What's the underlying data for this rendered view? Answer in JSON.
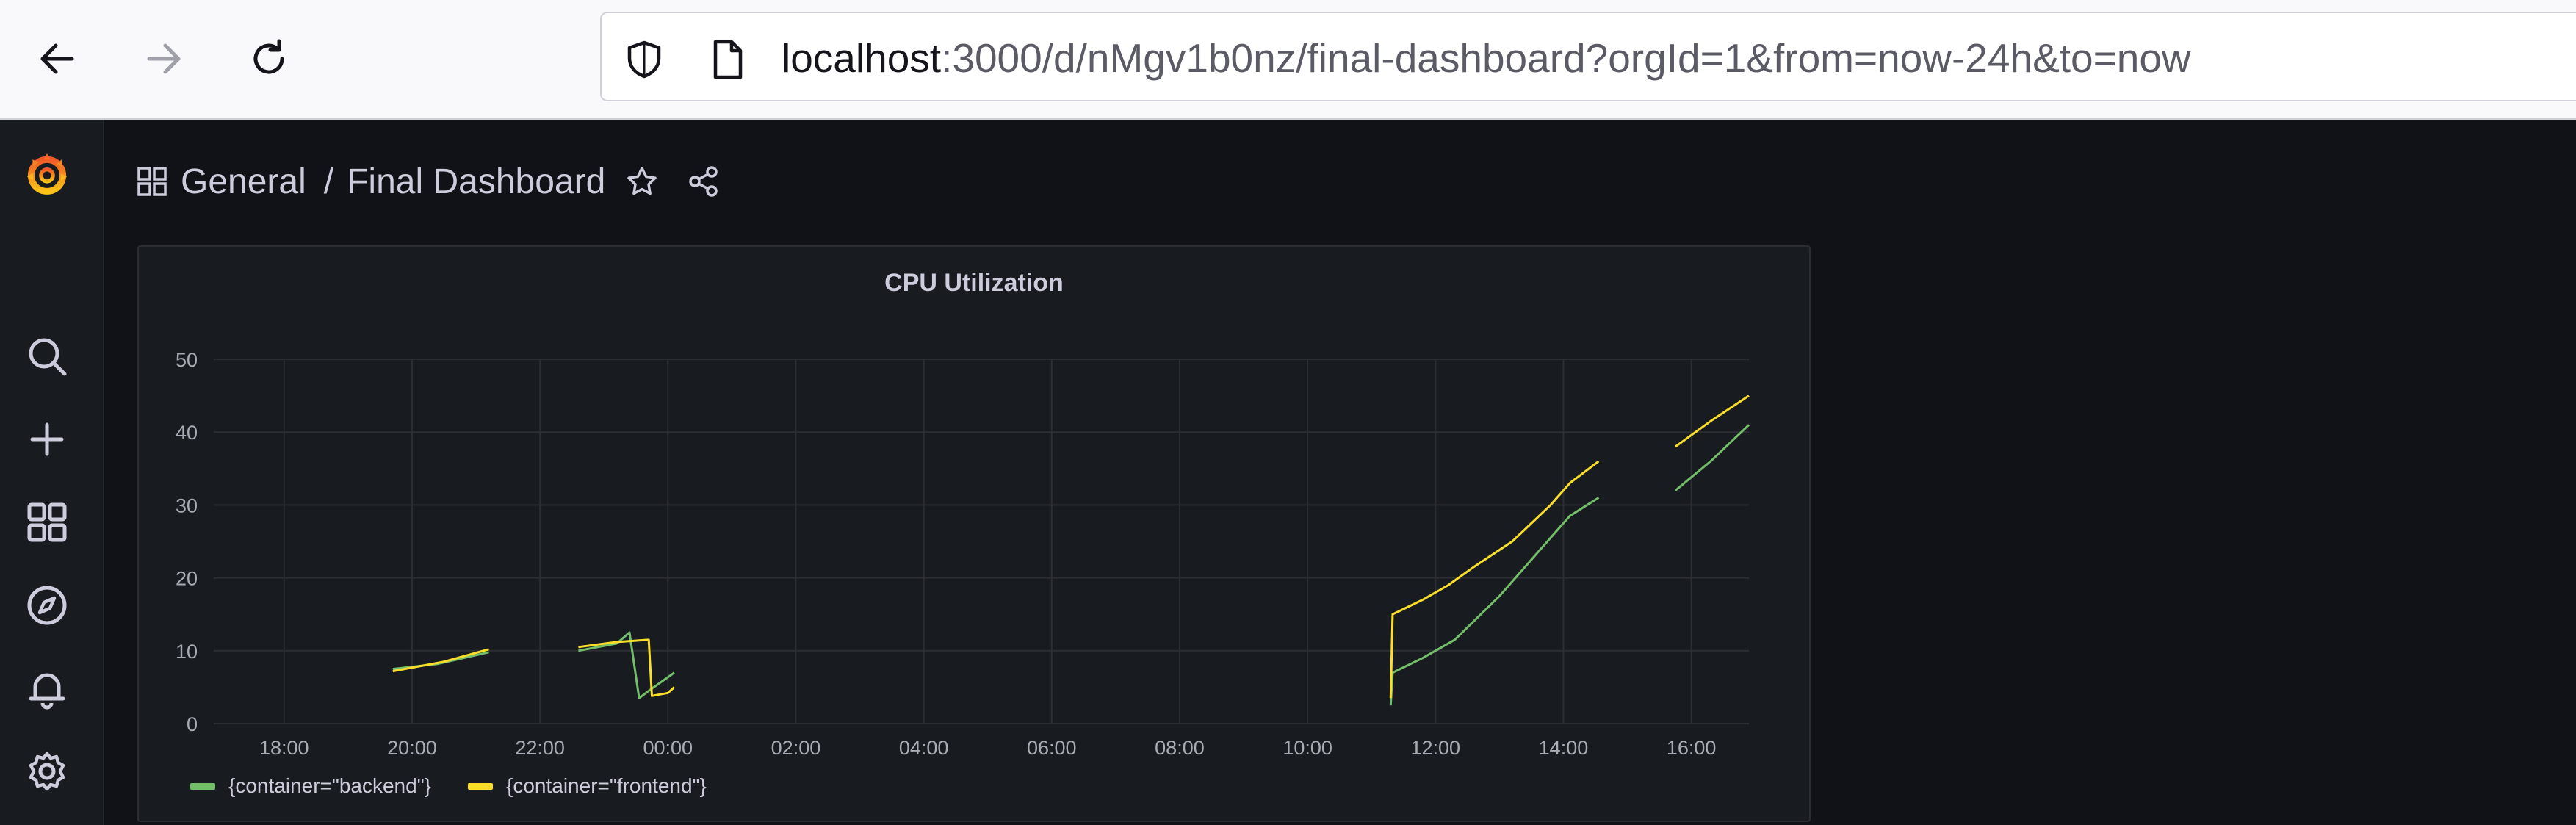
{
  "browser": {
    "url_host": "localhost",
    "url_rest": ":3000/d/nMgv1b0nz/final-dashboard?orgId=1&from=now-24h&to=now",
    "icons": [
      "back-arrow-icon",
      "forward-arrow-icon",
      "reload-icon",
      "shield-icon",
      "page-icon"
    ]
  },
  "sidebar": {
    "items": [
      "grafana-logo-icon",
      "search-icon",
      "plus-icon",
      "dashboards-icon",
      "explore-icon",
      "alerting-bell-icon",
      "settings-gear-icon"
    ]
  },
  "header": {
    "folder": "General",
    "separator": "/",
    "title": "Final Dashboard"
  },
  "colors": {
    "backend": "#73bf69",
    "frontend": "#fade2a",
    "grid": "#2b2e33",
    "tick_text": "#a9acb5"
  },
  "panel": {
    "title": "CPU Utilization",
    "legend": [
      {
        "label": "{container=\"backend\"}",
        "color": "#73bf69"
      },
      {
        "label": "{container=\"frontend\"}",
        "color": "#fade2a"
      }
    ]
  },
  "chart_data": {
    "type": "line",
    "title": "CPU Utilization",
    "xlabel": "",
    "ylabel": "",
    "ylim": [
      0,
      50
    ],
    "yticks": [
      0,
      10,
      20,
      30,
      40,
      50
    ],
    "x_unit": "hours",
    "xlim": [
      16.9,
      40.9
    ],
    "xtick_values": [
      18,
      20,
      22,
      24,
      26,
      28,
      30,
      32,
      34,
      36,
      38,
      40
    ],
    "xticks": [
      "18:00",
      "20:00",
      "22:00",
      "00:00",
      "02:00",
      "04:00",
      "06:00",
      "08:00",
      "10:00",
      "12:00",
      "14:00",
      "16:00"
    ],
    "grid": true,
    "legend_position": "bottom-left",
    "series": [
      {
        "name": "{container=\"backend\"}",
        "segments": [
          [
            [
              19.7,
              7.5
            ],
            [
              20.4,
              8.2
            ],
            [
              21.2,
              9.8
            ]
          ],
          [
            [
              22.6,
              10.0
            ],
            [
              23.2,
              11.0
            ],
            [
              23.4,
              12.5
            ],
            [
              23.55,
              3.5
            ],
            [
              23.7,
              4.5
            ],
            [
              24.1,
              7.0
            ]
          ],
          [
            [
              35.3,
              2.5
            ],
            [
              35.33,
              7.0
            ],
            [
              35.8,
              9.0
            ],
            [
              36.3,
              11.5
            ],
            [
              37.0,
              17.5
            ],
            [
              37.5,
              22.5
            ],
            [
              38.1,
              28.5
            ],
            [
              38.55,
              31.0
            ]
          ],
          [
            [
              39.75,
              32.0
            ],
            [
              40.3,
              36.0
            ],
            [
              40.9,
              41.0
            ]
          ]
        ]
      },
      {
        "name": "{container=\"frontend\"}",
        "segments": [
          [
            [
              19.7,
              7.2
            ],
            [
              20.5,
              8.5
            ],
            [
              21.2,
              10.2
            ]
          ],
          [
            [
              22.6,
              10.5
            ],
            [
              23.2,
              11.2
            ],
            [
              23.7,
              11.5
            ],
            [
              23.75,
              3.8
            ],
            [
              24.0,
              4.2
            ],
            [
              24.1,
              5.0
            ]
          ],
          [
            [
              35.3,
              3.5
            ],
            [
              35.33,
              15.0
            ],
            [
              35.8,
              17.0
            ],
            [
              36.2,
              19.0
            ],
            [
              36.6,
              21.5
            ],
            [
              37.2,
              25.0
            ],
            [
              37.8,
              30.0
            ],
            [
              38.1,
              33.0
            ],
            [
              38.55,
              36.0
            ]
          ],
          [
            [
              39.75,
              38.0
            ],
            [
              40.3,
              41.5
            ],
            [
              40.9,
              45.0
            ]
          ]
        ]
      }
    ]
  }
}
